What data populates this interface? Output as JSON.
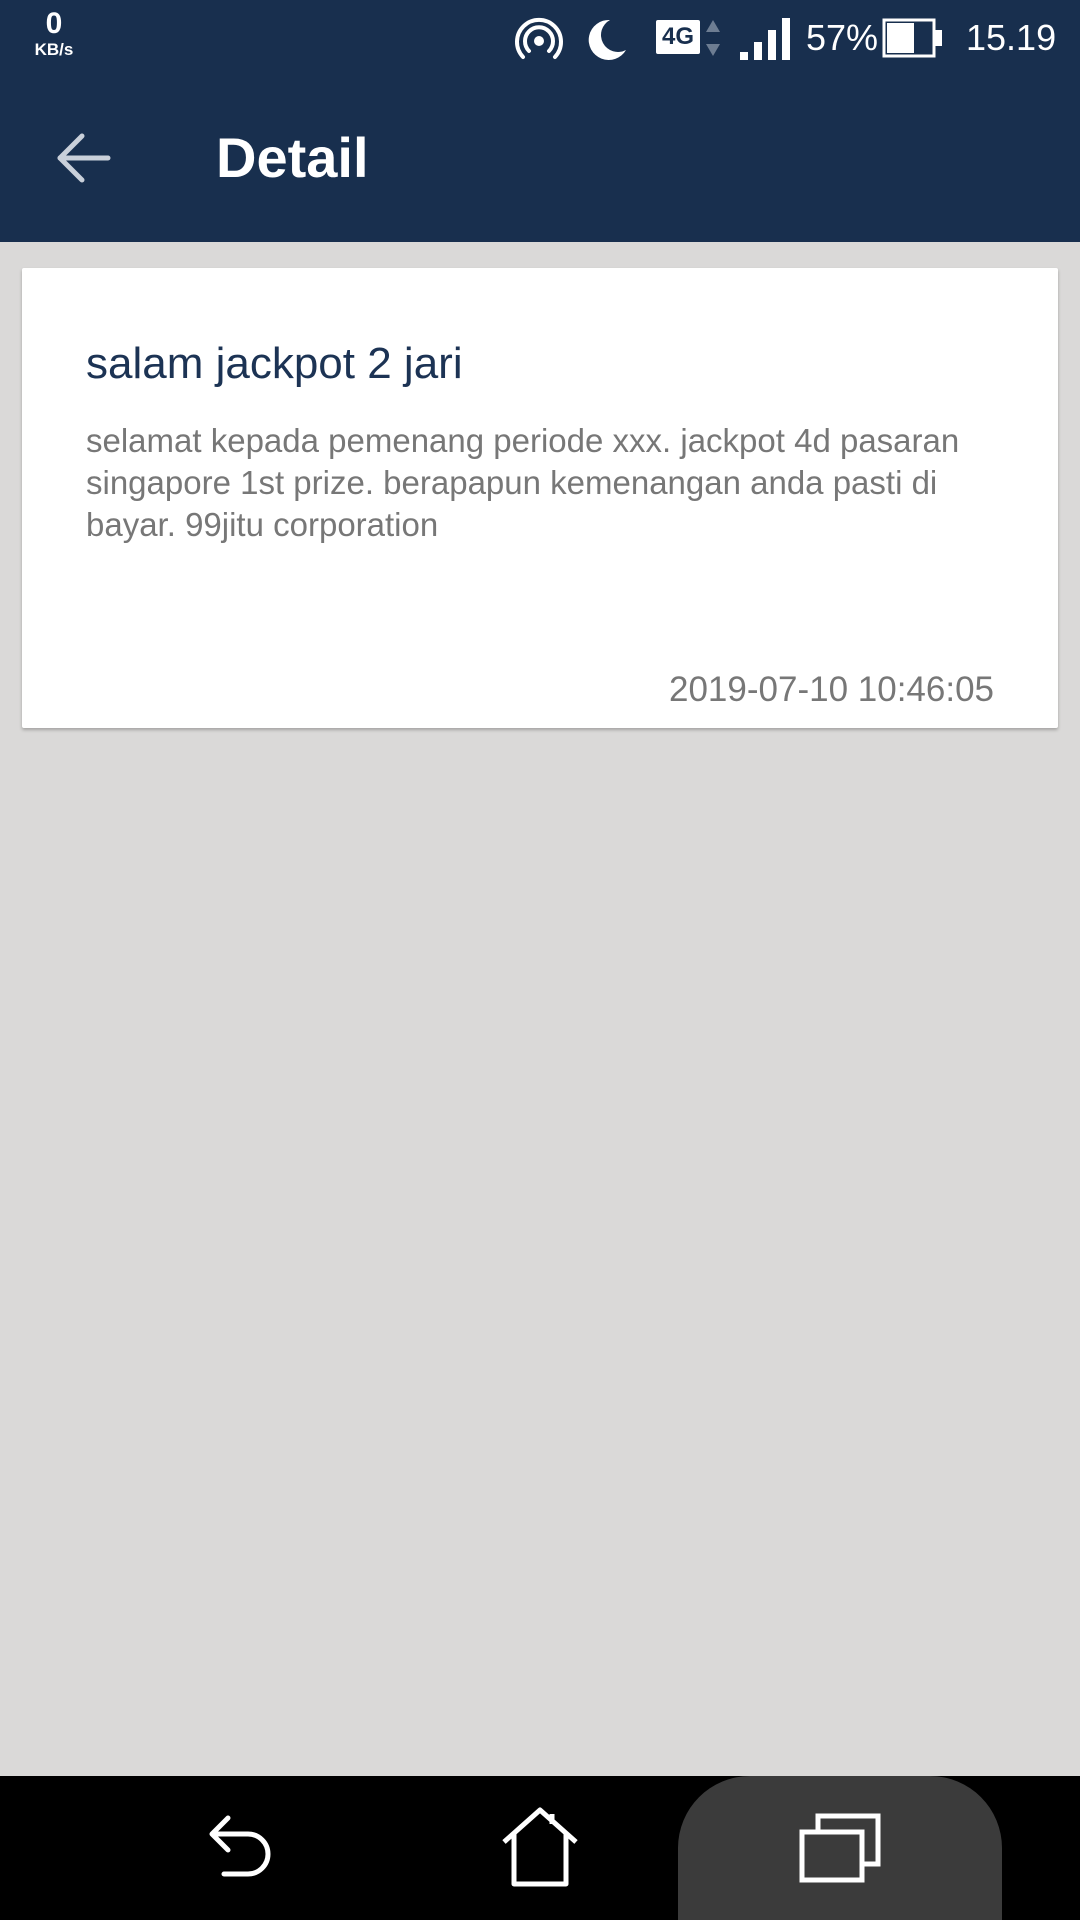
{
  "status_bar": {
    "speed_value": "0",
    "speed_unit": "KB/s",
    "network_type": "4G",
    "battery_percent": "57%",
    "time": "15.19"
  },
  "toolbar": {
    "title": "Detail"
  },
  "message": {
    "title": "salam jackpot 2 jari",
    "body": "selamat kepada pemenang periode xxx. jackpot 4d pasaran singapore 1st prize. berapapun kemenangan anda pasti di bayar. 99jitu corporation",
    "timestamp": "2019-07-10 10:46:05"
  },
  "colors": {
    "primary": "#182f4e",
    "background": "#dad9d8",
    "card": "#ffffff"
  }
}
